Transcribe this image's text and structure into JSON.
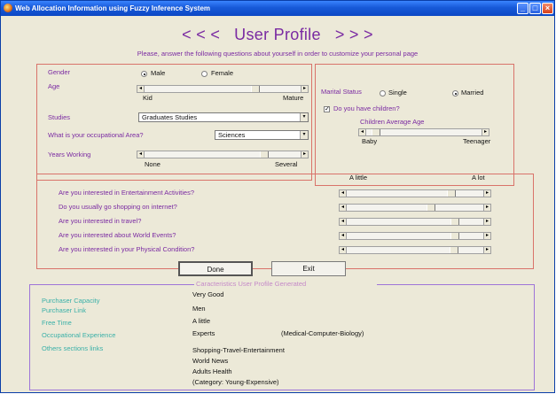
{
  "window": {
    "title": "Web Allocation Information using Fuzzy Inference System"
  },
  "header": {
    "left_arrows": "< < <",
    "title": "User Profile",
    "right_arrows": "> > >",
    "subtitle": "Please, answer the following questions about yourself in order to customize your personal page"
  },
  "personal": {
    "gender_label": "Gender",
    "gender_options": [
      "Male",
      "Female"
    ],
    "gender_selected": "Male",
    "age_label": "Age",
    "age_slider": {
      "value": 0.72,
      "min_label": "Kid",
      "max_label": "Mature"
    },
    "studies_label": "Studies",
    "studies_value": "Graduates Studies",
    "occupation_label": "What is your occupational Area?",
    "occupation_value": "Sciences",
    "years_label": "Years Working",
    "years_slider": {
      "value": 0.78,
      "min_label": "None",
      "max_label": "Several"
    }
  },
  "family": {
    "marital_label": "Marital Status",
    "marital_options": [
      "Single",
      "Married"
    ],
    "marital_selected": "Married",
    "children_label": "Do you have children?",
    "children_checked": "✓",
    "children_age_label": "Children Average Age",
    "children_age_slider": {
      "value": 0.06,
      "min_label": "Baby",
      "max_label": "Teenager"
    }
  },
  "interests": {
    "scale_min": "A little",
    "scale_max": "A lot",
    "questions": [
      {
        "label": "Are you interested in Entertainment Activities?",
        "value": 0.78
      },
      {
        "label": "Do you usually go shopping on internet?",
        "value": 0.62
      },
      {
        "label": "Are you interested in travel?",
        "value": 0.81
      },
      {
        "label": "Are you interested about World Events?",
        "value": 0.81
      },
      {
        "label": "Are you interested in your Physical Condition?",
        "value": 0.8
      }
    ]
  },
  "actions": {
    "done": "Done",
    "exit": "Exit"
  },
  "results": {
    "title": "Caracteristics User Profile Generated",
    "rows": [
      {
        "label": "Purchaser Capacity",
        "value": "Very Good"
      },
      {
        "label": "Purchaser Link",
        "value": "Men"
      },
      {
        "label": "Free Time",
        "value": "A little"
      },
      {
        "label": "Occupational Experience",
        "value": "Experts",
        "extra": "(Medical-Computer-Biology)"
      },
      {
        "label": "Others sections links",
        "value": "Shopping-Travel-Entertainment"
      }
    ],
    "more_links": [
      "World News",
      "Adults Health",
      "(Category: Young-Expensive)"
    ]
  },
  "colors": {
    "accent": "#7a2aa2",
    "panel_border": "#d9736a",
    "results_border": "#9e74d8",
    "teal": "#3ab0a8",
    "titlebar": "#1759d8"
  }
}
